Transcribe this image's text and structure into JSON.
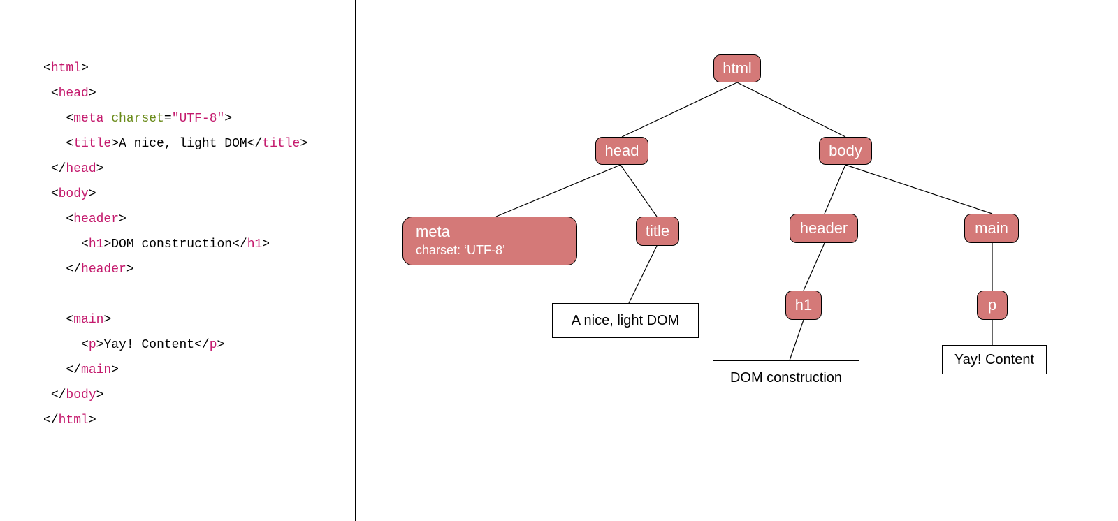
{
  "code": {
    "indent1": " ",
    "indent2": "   ",
    "indent3": "     ",
    "tag_html": "html",
    "tag_head": "head",
    "tag_meta": "meta",
    "attr_charset_name": "charset",
    "attr_charset_value": "\"UTF-8\"",
    "tag_title": "title",
    "title_text": "A nice, light DOM",
    "tag_body": "body",
    "tag_header": "header",
    "tag_h1": "h1",
    "h1_text": "DOM construction",
    "tag_main": "main",
    "tag_p": "p",
    "p_text": "Yay! Content"
  },
  "tree": {
    "html": "html",
    "head": "head",
    "body": "body",
    "meta_label": "meta",
    "meta_sub": "charset: ‘UTF-8’",
    "title": "title",
    "header": "header",
    "main": "main",
    "h1": "h1",
    "p": "p",
    "title_leaf": "A nice, light DOM",
    "h1_leaf": "DOM construction",
    "p_leaf": "Yay! Content"
  },
  "colors": {
    "node_fill": "#d47978",
    "tag_color": "#c41a6d",
    "attr_color": "#6a8b1a"
  }
}
